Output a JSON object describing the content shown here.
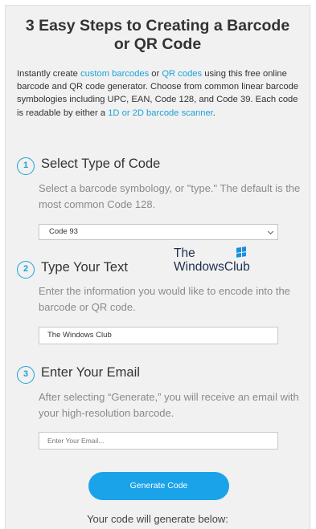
{
  "header": {
    "title_line1": "3 Easy Steps to Creating a Barcode",
    "title_line2": "or QR Code"
  },
  "intro": {
    "text1": "Instantly create ",
    "link1": "custom barcodes",
    "text2": " or ",
    "link2": "QR codes",
    "text3": " using this free online barcode and QR code generator. Choose from common linear barcode symbologies including UPC, EAN, Code 128, and Code 39. Each code is readable by either a ",
    "link3": "1D or 2D barcode scanner",
    "text4": "."
  },
  "steps": [
    {
      "number": "1",
      "title": "Select Type of Code",
      "description": "Select a barcode symbology, or \"type.\" The default is the most common Code 128.",
      "select_value": "Code 93"
    },
    {
      "number": "2",
      "title": "Type Your Text",
      "description": "Enter the information you would like to encode into the barcode or QR code.",
      "input_value": "The Windows Club"
    },
    {
      "number": "3",
      "title": "Enter Your Email",
      "description": "After selecting “Generate,” you will receive an email with your high-resolution barcode.",
      "input_placeholder": "Enter Your Email..."
    }
  ],
  "generate_button": "Generate Code",
  "footer_text": "Your code will generate below:",
  "watermark": {
    "line1": "The",
    "line2": "WindowsClub",
    "logo_icon": "windows-logo-icon",
    "logo_color": "#1a8fe0"
  },
  "colors": {
    "accent": "#1aa3d6",
    "button": "#1aa3e8",
    "panel_bg": "#f1f1f1"
  }
}
